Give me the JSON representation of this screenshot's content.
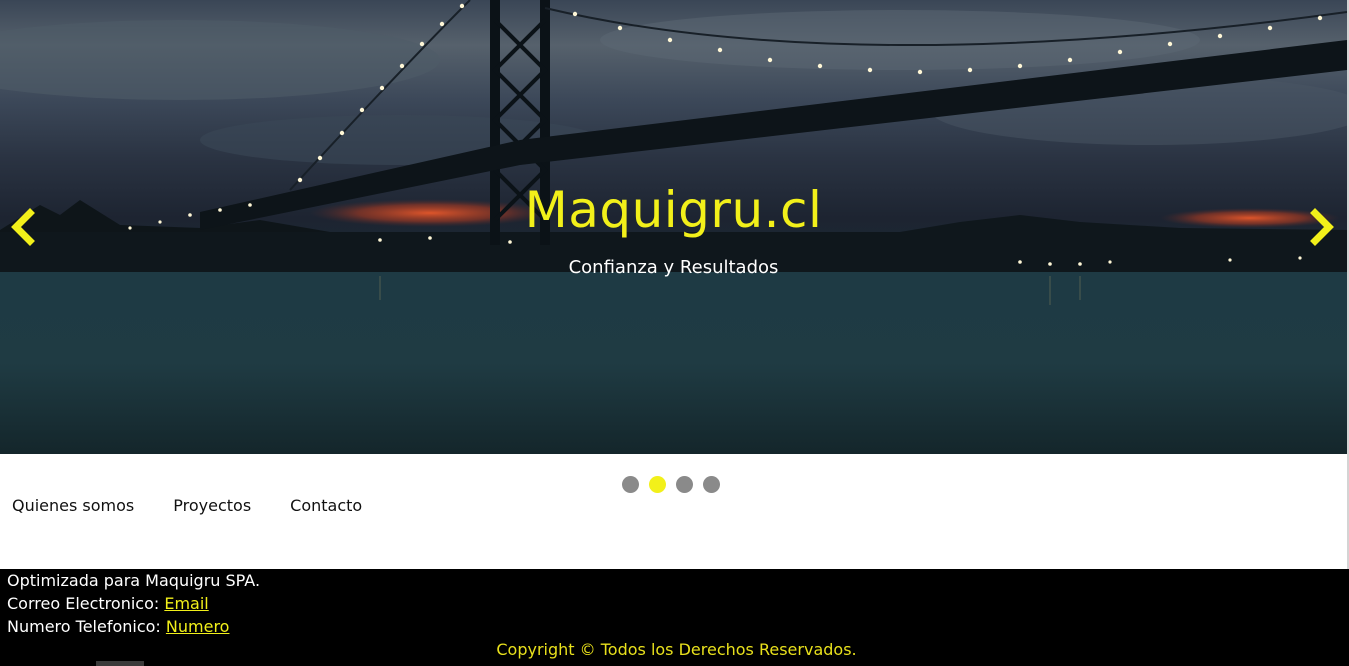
{
  "hero": {
    "title": "Maquigru.cl",
    "subtitle": "Confianza y Resultados",
    "prev_arrow_icon": "chevron-left-icon",
    "next_arrow_icon": "chevron-right-icon",
    "accent_color": "#f2f01a"
  },
  "carousel": {
    "slide_count": 4,
    "active_index": 1,
    "dot_color": "#8a8a8a",
    "active_dot_color": "#f2f01a"
  },
  "nav": {
    "items": [
      {
        "label": "Quienes somos"
      },
      {
        "label": "Proyectos"
      },
      {
        "label": "Contacto"
      }
    ]
  },
  "footer": {
    "line1": "Optimizada para Maquigru SPA.",
    "email_label": "Correo Electronico: ",
    "email_link": "Email",
    "phone_label": "Numero Telefonico: ",
    "phone_link": "Numero",
    "copyright": "Copyright © Todos los Derechos Reservados.",
    "background_color": "#000000",
    "link_color": "#f2f01a"
  }
}
